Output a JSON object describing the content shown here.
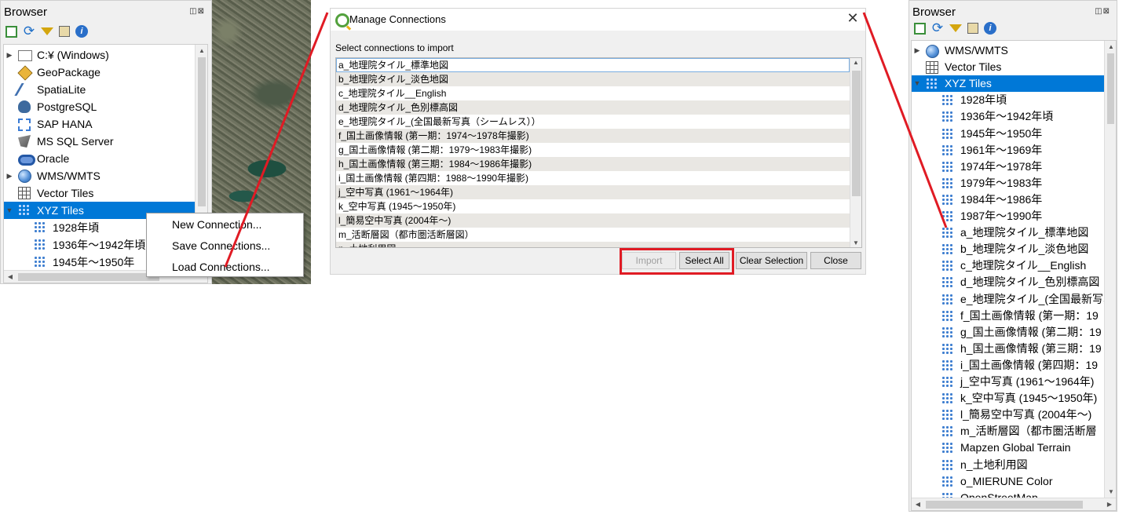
{
  "browser_left": {
    "title": "Browser",
    "panel_buttons": "◫⊠",
    "toolbar_icons": [
      "add-layer-icon",
      "refresh-icon",
      "filter-icon",
      "collapse-all-icon",
      "info-icon"
    ],
    "items": [
      {
        "label": "C:¥ (Windows)",
        "icon": "folder-icon",
        "expander": "▶"
      },
      {
        "label": "GeoPackage",
        "icon": "geopackage-icon"
      },
      {
        "label": "SpatiaLite",
        "icon": "spatialite-icon"
      },
      {
        "label": "PostgreSQL",
        "icon": "postgresql-icon"
      },
      {
        "label": "SAP HANA",
        "icon": "sap-hana-icon"
      },
      {
        "label": "MS SQL Server",
        "icon": "mssql-icon"
      },
      {
        "label": "Oracle",
        "icon": "oracle-icon"
      },
      {
        "label": "WMS/WMTS",
        "icon": "globe-icon",
        "expander": "▶"
      },
      {
        "label": "Vector Tiles",
        "icon": "vector-tiles-icon"
      },
      {
        "label": "XYZ Tiles",
        "icon": "xyz-tiles-icon",
        "expander": "▼",
        "selected": true
      },
      {
        "label": "1928年頃",
        "icon": "xyz-tiles-icon",
        "child": true
      },
      {
        "label": "1936年〜1942年頃",
        "icon": "xyz-tiles-icon",
        "child": true
      },
      {
        "label": "1945年〜1950年",
        "icon": "xyz-tiles-icon",
        "child": true
      }
    ]
  },
  "context_menu": {
    "items": [
      "New Connection...",
      "Save Connections...",
      "Load Connections..."
    ]
  },
  "dialog": {
    "title": "Manage Connections",
    "close": "✕",
    "label": "Select connections to import",
    "connections": [
      "a_地理院タイル_標準地図",
      "b_地理院タイル_淡色地図",
      "c_地理院タイル__English",
      "d_地理院タイル_色別標高図",
      "e_地理院タイル_(全国最新写真（シームレス））",
      "f_国土画像情報 (第一期：1974〜1978年撮影)",
      "g_国土画像情報 (第二期：1979〜1983年撮影)",
      "h_国土画像情報 (第三期：1984〜1986年撮影)",
      "i_国土画像情報 (第四期：1988〜1990年撮影)",
      "j_空中写真 (1961〜1964年)",
      "k_空中写真 (1945〜1950年)",
      "l_簡易空中写真 (2004年〜)",
      "m_活断層図（都市圏活断層図）",
      "n_土地利用図"
    ],
    "buttons": {
      "import": "Import",
      "select_all": "Select All",
      "clear_selection": "Clear Selection",
      "close": "Close"
    }
  },
  "browser_right": {
    "title": "Browser",
    "panel_buttons": "◫⊠",
    "items": [
      {
        "label": "WMS/WMTS",
        "icon": "globe-icon",
        "expander": "▶"
      },
      {
        "label": "Vector Tiles",
        "icon": "vector-tiles-icon"
      },
      {
        "label": "XYZ Tiles",
        "icon": "xyz-tiles-icon",
        "expander": "▼",
        "selected": true
      },
      {
        "label": "1928年頃",
        "child": true
      },
      {
        "label": "1936年〜1942年頃",
        "child": true
      },
      {
        "label": "1945年〜1950年",
        "child": true
      },
      {
        "label": "1961年〜1969年",
        "child": true
      },
      {
        "label": "1974年〜1978年",
        "child": true
      },
      {
        "label": "1979年〜1983年",
        "child": true
      },
      {
        "label": "1984年〜1986年",
        "child": true
      },
      {
        "label": "1987年〜1990年",
        "child": true
      },
      {
        "label": "a_地理院タイル_標準地図",
        "child": true
      },
      {
        "label": "b_地理院タイル_淡色地図",
        "child": true
      },
      {
        "label": "c_地理院タイル__English",
        "child": true
      },
      {
        "label": "d_地理院タイル_色別標高図",
        "child": true
      },
      {
        "label": "e_地理院タイル_(全国最新写真",
        "child": true
      },
      {
        "label": "f_国土画像情報 (第一期：19",
        "child": true
      },
      {
        "label": "g_国土画像情報 (第二期：19",
        "child": true
      },
      {
        "label": "h_国土画像情報 (第三期：19",
        "child": true
      },
      {
        "label": "i_国土画像情報 (第四期：19",
        "child": true
      },
      {
        "label": "j_空中写真 (1961〜1964年)",
        "child": true
      },
      {
        "label": "k_空中写真 (1945〜1950年)",
        "child": true
      },
      {
        "label": "l_簡易空中写真 (2004年〜)",
        "child": true
      },
      {
        "label": "m_活断層図（都市圏活断層",
        "child": true
      },
      {
        "label": "Mapzen Global Terrain",
        "child": true
      },
      {
        "label": "n_土地利用図",
        "child": true
      },
      {
        "label": "o_MIERUNE Color",
        "child": true
      },
      {
        "label": "OpenStreetMap",
        "child": true
      }
    ]
  },
  "colors": {
    "selection": "#0078d7",
    "highlight": "#e01b24",
    "xyz_icon": "#3f7fd0"
  }
}
